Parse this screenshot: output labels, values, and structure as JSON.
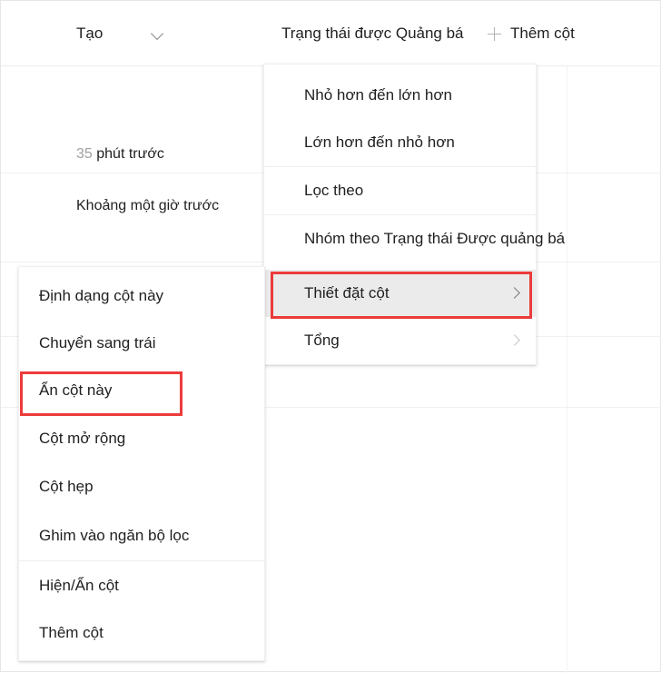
{
  "list_view": {
    "columns": [
      {
        "label": "Tạo",
        "icon": "chevron-down-icon"
      },
      {
        "label": "Trạng thái được Quảng bá",
        "icon": "chevron-down-icon"
      }
    ],
    "add_column": {
      "label": "Thêm cột",
      "icon": "plus-icon"
    },
    "rows": [
      {
        "created_prefix": "35",
        "created_text": "phút trước"
      },
      {
        "created_prefix": "",
        "created_text": "Khoảng một giờ trước"
      }
    ]
  },
  "column_dropdown": {
    "items": [
      {
        "label": "Nhỏ hơn đến lớn hơn",
        "submenu": false,
        "separator_above": false,
        "highlighted": false
      },
      {
        "label": "Lớn hơn đến nhỏ hơn",
        "submenu": false,
        "separator_above": false,
        "highlighted": false
      },
      {
        "label": "Lọc theo",
        "submenu": false,
        "separator_above": true,
        "highlighted": false
      },
      {
        "label": "Nhóm theo Trạng thái Được quảng bá",
        "submenu": false,
        "separator_above": true,
        "highlighted": false
      },
      {
        "label": "Thiết đặt cột",
        "submenu": true,
        "separator_above": false,
        "highlighted": true
      },
      {
        "label": "Tổng",
        "submenu": true,
        "separator_above": false,
        "highlighted": false
      }
    ]
  },
  "column_settings_submenu": {
    "items": [
      {
        "label": "Định dạng cột này",
        "separator_above": false,
        "highlighted": false
      },
      {
        "label": "Chuyển sang trái",
        "separator_above": false,
        "highlighted": false
      },
      {
        "label": "Ẩn cột này",
        "separator_above": false,
        "highlighted": false
      },
      {
        "label": "Cột mở rộng",
        "separator_above": false,
        "highlighted": false
      },
      {
        "label": "Cột hẹp",
        "separator_above": false,
        "highlighted": false
      },
      {
        "label": "Ghim vào ngăn bộ lọc",
        "separator_above": false,
        "highlighted": false
      },
      {
        "label": "Hiện/Ẩn cột",
        "separator_above": true,
        "highlighted": false
      },
      {
        "label": "Thêm cột",
        "separator_above": false,
        "highlighted": false
      }
    ]
  },
  "annotations": {
    "highlight_color": "#ec3b3b",
    "boxes": [
      {
        "target": "Ẩn cột này"
      },
      {
        "target": "Thiết đặt cột"
      }
    ]
  }
}
